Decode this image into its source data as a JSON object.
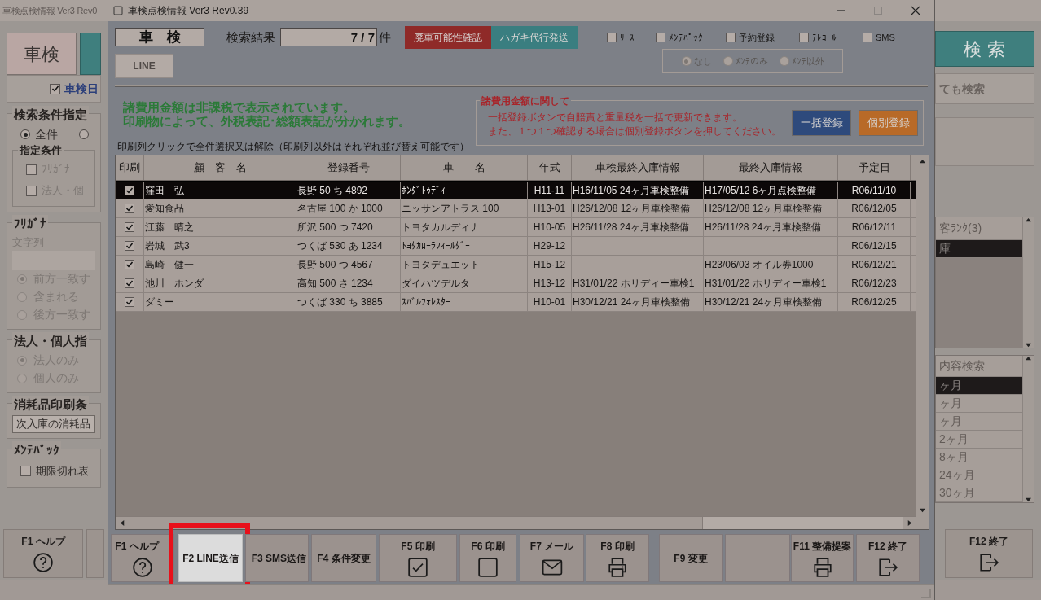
{
  "background_window": {
    "title": "車検点検情報 Ver3 Rev0",
    "tab": {
      "label": "車検",
      "selected": true
    },
    "date_checkbox": {
      "label": "車検日",
      "checked": true
    },
    "groups": [
      {
        "title": "検索条件指定",
        "items": [
          {
            "kind": "radios",
            "options": [
              {
                "label": "全件",
                "selected": true
              },
              {
                "selected": false
              }
            ]
          },
          {
            "kind": "group",
            "title": "指定条件",
            "items": [
              {
                "kind": "checkbox",
                "label": "ﾌﾘｶﾞﾅ",
                "checked": false,
                "disabled": true
              },
              {
                "kind": "checkbox",
                "label": "法人・個",
                "checked": false,
                "disabled": true
              }
            ]
          }
        ]
      },
      {
        "title": "ﾌﾘｶﾞﾅ",
        "items": [
          {
            "kind": "caption",
            "label": "文字列",
            "disabled": true
          },
          {
            "kind": "input",
            "disabled": true
          },
          {
            "kind": "radio",
            "label": "前方一致す",
            "selected": true,
            "disabled": true
          },
          {
            "kind": "radio",
            "label": "含まれる",
            "selected": false,
            "disabled": true
          },
          {
            "kind": "radio",
            "label": "後方一致す",
            "selected": false,
            "disabled": true
          }
        ]
      },
      {
        "title": "法人・個人指",
        "items": [
          {
            "kind": "radio",
            "label": "法人のみ",
            "selected": true,
            "disabled": true
          },
          {
            "kind": "radio",
            "label": "個人のみ",
            "selected": false,
            "disabled": true
          }
        ]
      },
      {
        "title": "消耗品印刷条",
        "items": [
          {
            "kind": "select",
            "value": "次入庫の消耗品"
          }
        ]
      },
      {
        "title": "ﾒﾝﾃﾊﾟｯｸ",
        "items": [
          {
            "kind": "checkbox",
            "label": "期限切れ表",
            "checked": false,
            "disabled": false
          }
        ]
      }
    ],
    "search_button": "検 索",
    "search_option_text": "ても検索",
    "rank_list": {
      "header": "客ﾗﾝｸ(3)",
      "items": [
        {
          "label": "庫",
          "selected": true
        }
      ]
    },
    "content_list": {
      "header": "内容検索",
      "items": [
        {
          "label": "ヶ月",
          "selected": true
        },
        {
          "label": "ヶ月",
          "selected": false
        },
        {
          "label": "ヶ月",
          "selected": false
        },
        {
          "label": "2ヶ月",
          "selected": false
        },
        {
          "label": "8ヶ月",
          "selected": false
        },
        {
          "label": "24ヶ月",
          "selected": false
        },
        {
          "label": "30ヶ月",
          "selected": false
        }
      ]
    },
    "function_keys": [
      {
        "label": "F1 ヘルプ",
        "kind": "help"
      },
      {
        "label": "F12 終了",
        "kind": "exit"
      }
    ]
  },
  "dialog": {
    "title": "車検点検情報 Ver3 Rev0.39",
    "mode_label": "車　検",
    "result_label": "検索結果",
    "result_value": "7 / 7",
    "result_unit": "件",
    "action_buttons": [
      {
        "label": "廃車可能性確認",
        "color": "#8f2a28"
      },
      {
        "label": "ハガキ代行発送",
        "color": "#3a7e80"
      }
    ],
    "filters": [
      {
        "label": "ﾘｰｽ",
        "checked": false
      },
      {
        "label": "ﾒﾝﾃﾊﾟｯｸ",
        "checked": false
      },
      {
        "label": "予約登録",
        "checked": false
      },
      {
        "label": "ﾃﾚｺｰﾙ",
        "checked": false
      },
      {
        "label": "SMS",
        "checked": false
      }
    ],
    "maintenance_filter": {
      "disabled": true,
      "options": [
        {
          "label": "なし",
          "selected": true
        },
        {
          "label": "ﾒﾝﾃのみ",
          "selected": false
        },
        {
          "label": "ﾒﾝﾃ以外",
          "selected": false
        }
      ]
    },
    "line_button": "LINE",
    "tax_notice": [
      "諸費用金額は非課税で表示されています。",
      "印刷物によって、外税表記･総額表記が分かれます。"
    ],
    "fee_notice": {
      "title": "諸費用金額に関して",
      "lines": [
        "一括登録ボタンで自賠責と重量税を一括で更新できます。",
        "また、１つ１つ確認する場合は個別登録ボタンを押してください。"
      ],
      "buttons": [
        {
          "label": "一括登録",
          "color": "#2e4a7c"
        },
        {
          "label": "個別登録",
          "color": "#b86a28"
        }
      ]
    },
    "table_hint": "印刷列クリックで全件選択又は解除（印刷列以外はそれぞれ並び替え可能です）",
    "table": {
      "print_column": "印刷",
      "columns": [
        "顧　客　名",
        "登録番号",
        "車　　名",
        "年式",
        "車検最終入庫情報",
        "最終入庫情報",
        "予定日"
      ],
      "rows": [
        {
          "selected": true,
          "print": true,
          "cells": [
            "窪田　弘",
            "長野 50 ち 4892",
            "ﾎﾝﾀﾞﾄｩﾃﾞｨ",
            "H11-11",
            "H16/11/05 24ヶ月車検整備",
            "H17/05/12 6ヶ月点検整備",
            "R06/11/10"
          ]
        },
        {
          "selected": false,
          "print": true,
          "cells": [
            "愛知食品",
            "名古屋 100 か 1000",
            "ニッサンアトラス 100",
            "H13-01",
            "H26/12/08 12ヶ月車検整備",
            "H26/12/08 12ヶ月車検整備",
            "R06/12/05"
          ]
        },
        {
          "selected": false,
          "print": true,
          "cells": [
            "江藤　晴之",
            "所沢 500 つ 7420",
            "トヨタカルディナ",
            "H10-05",
            "H26/11/28 24ヶ月車検整備",
            "H26/11/28 24ヶ月車検整備",
            "R06/12/11"
          ]
        },
        {
          "selected": false,
          "print": true,
          "cells": [
            "岩城　武3",
            "つくば 530 あ 1234",
            "ﾄﾖﾀｶﾛｰﾗﾌｨｰﾙﾀﾞｰ",
            "H29-12",
            null,
            null,
            "R06/12/15"
          ]
        },
        {
          "selected": false,
          "print": true,
          "cells": [
            "島崎　健一",
            "長野 500 つ 4567",
            "トヨタデュエット",
            "H15-12",
            null,
            "H23/06/03 オイル券1000",
            "R06/12/21"
          ]
        },
        {
          "selected": false,
          "print": true,
          "cells": [
            "池川　ホンダ",
            "高知 500 さ 1234",
            "ダイハツデルタ",
            "H13-12",
            "H31/01/22 ホリディー車検1",
            "H31/01/22 ホリディー車検1",
            "R06/12/23"
          ]
        },
        {
          "selected": false,
          "print": true,
          "cells": [
            "ダミー",
            "つくば 330 ち 3885",
            "ｽﾊﾞﾙﾌｫﾚｽﾀｰ",
            "H10-01",
            "H30/12/21 24ヶ月車検整備",
            "H30/12/21 24ヶ月車検整備",
            "R06/12/25"
          ]
        }
      ]
    },
    "function_keys": [
      {
        "label": "F1 ヘルプ",
        "kind": "help",
        "highlighted": false
      },
      {
        "label": "F2 LINE送信",
        "kind": "text",
        "highlighted": true
      },
      {
        "label": "F3 SMS送信",
        "kind": "text",
        "highlighted": false
      },
      {
        "label": "F4 条件変更",
        "kind": "text",
        "highlighted": false
      },
      {
        "label": "F5 印刷",
        "kind": "check",
        "highlighted": false
      },
      {
        "label": "F6 印刷",
        "kind": "square",
        "highlighted": false
      },
      {
        "label": "F7 メール",
        "kind": "mail",
        "highlighted": false
      },
      {
        "label": "F8 印刷",
        "kind": "printer",
        "highlighted": false
      },
      {
        "label": "F9 変更",
        "kind": "text",
        "highlighted": false
      },
      {
        "kind": "blank",
        "highlighted": false
      },
      {
        "label": "F11 整備提案",
        "kind": "printer",
        "highlighted": false
      },
      {
        "label": "F12 終了",
        "kind": "exit",
        "highlighted": false
      }
    ]
  }
}
